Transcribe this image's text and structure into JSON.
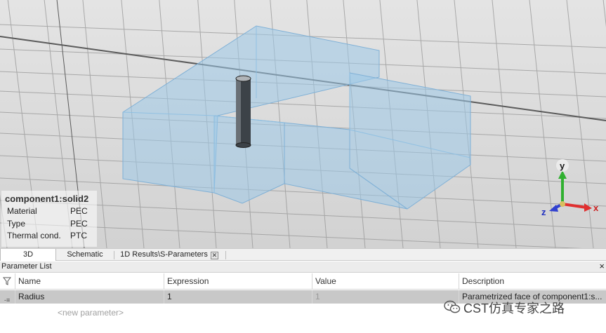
{
  "viewport": {
    "info_panel": {
      "title": "component1:solid2",
      "rows": [
        {
          "key": "Material",
          "value": "PEC"
        },
        {
          "key": "Type",
          "value": "PEC"
        },
        {
          "key": "Thermal cond.",
          "value": "PTC"
        }
      ]
    },
    "axes": {
      "x": "x",
      "y": "y",
      "z": "z"
    }
  },
  "tabs": [
    {
      "label": "3D",
      "active": true
    },
    {
      "label": "Schematic",
      "active": false
    },
    {
      "label": "1D Results\\S-Parameters",
      "active": false,
      "closable": true
    }
  ],
  "param_list": {
    "title": "Parameter List",
    "close_label": "×",
    "columns": {
      "name": "Name",
      "expression": "Expression",
      "value": "Value",
      "description": "Description"
    },
    "rows": [
      {
        "name": "Radius",
        "expression": "1",
        "value": "1",
        "description": "Parametrized face of component1:s..."
      }
    ],
    "new_param_placeholder": "<new parameter>"
  },
  "watermark": {
    "text": "CST仿真专家之路"
  },
  "colors": {
    "solid": "#9cc8e8",
    "pin": "#3c4248",
    "x_axis": "#e03030",
    "y_axis": "#30b030",
    "z_axis": "#3040d0"
  }
}
